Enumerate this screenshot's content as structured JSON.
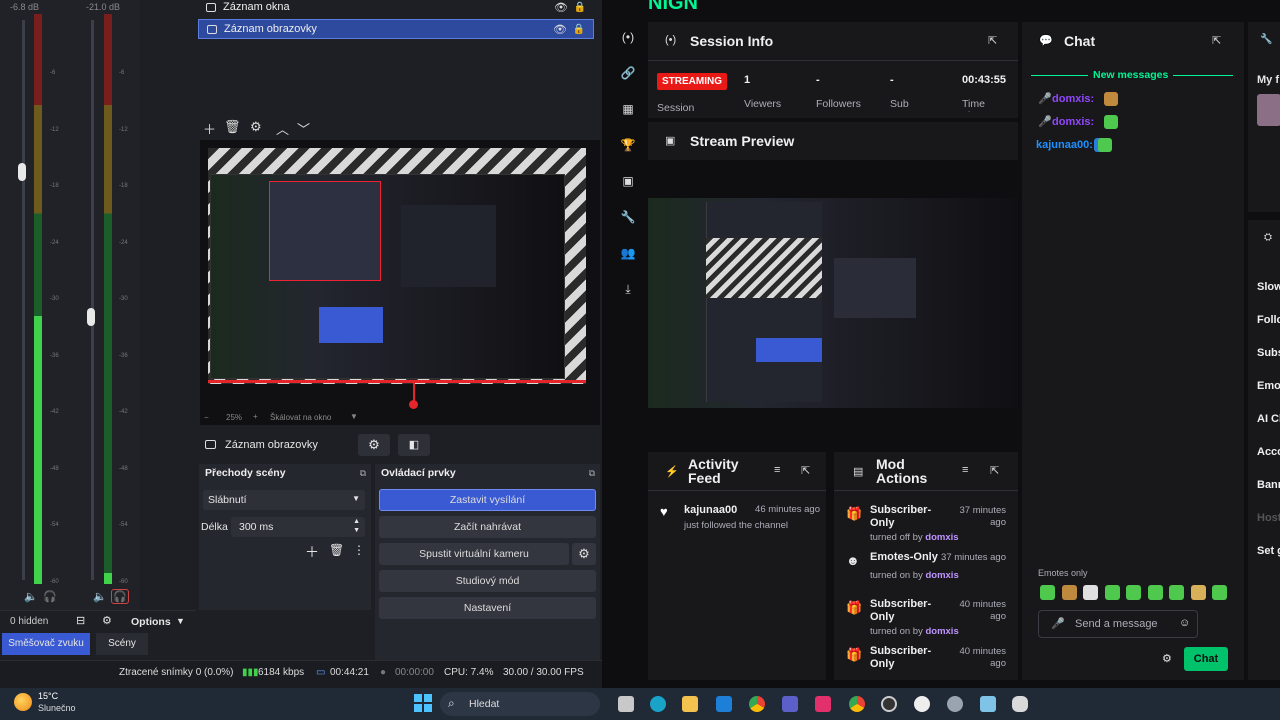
{
  "mixer": {
    "db_left": "-6.8 dB",
    "db_right": "-21.0 dB",
    "ticks": [
      "-6",
      "-12",
      "-18",
      "-24",
      "-30",
      "-36",
      "-42",
      "-48",
      "-54",
      "-60"
    ],
    "level_left": 0.47,
    "level_right": 0.02,
    "hidden_label": "0 hidden",
    "options_label": "Options"
  },
  "sources": {
    "items": [
      {
        "label": "Záznam okna",
        "selected": false
      },
      {
        "label": "Záznam obrazovky",
        "selected": true
      }
    ]
  },
  "preview": {
    "zoom": "25%",
    "scale_label": "Škálovat na okno"
  },
  "source_bar": {
    "label": "Záznam obrazovky"
  },
  "transitions": {
    "title": "Přechody scény",
    "selected": "Slábnutí",
    "duration_label": "Délka",
    "duration_value": "300 ms"
  },
  "controls": {
    "title": "Ovládací prvky",
    "start_stream": "Zastavit vysílání",
    "start_record": "Začít nahrávat",
    "virtual_cam": "Spustit virtuální kameru",
    "studio_mode": "Studiový mód",
    "settings": "Nastavení"
  },
  "docks": {
    "tab_mixer": "Směšovač zvuku",
    "tab_scenes": "Scény"
  },
  "status": {
    "dropped": "Ztracené snímky 0 (0.0%)",
    "bitrate": "6184 kbps",
    "live_time": "00:44:21",
    "rec_time": "00:00:00",
    "cpu": "CPU: 7.4%",
    "fps": "30.00 / 30.00 FPS"
  },
  "dashboard": {
    "brand_partial": "NIGN",
    "session": {
      "title": "Session Info",
      "live_badge": "STREAMING",
      "session_label": "Session",
      "viewers_value": "1",
      "viewers_label": "Viewers",
      "followers_value": "-",
      "followers_label": "Followers",
      "subs_value": "-",
      "subs_label": "Sub Counts",
      "time_value": "00:43:55",
      "time_label": "Time Live"
    },
    "preview_title": "Stream Preview",
    "chat": {
      "title": "Chat",
      "new_messages": "New messages",
      "messages": [
        {
          "user": "domxis:",
          "color": "#9147ff"
        },
        {
          "user": "domxis:",
          "color": "#9147ff"
        },
        {
          "user": "kajunaa00:",
          "color": "#1e90ff"
        }
      ],
      "emotes_only": "Emotes only",
      "input_placeholder": "Send a message",
      "send_label": "Chat"
    },
    "activity": {
      "title": "Activity Feed",
      "items": [
        {
          "user": "kajunaa00",
          "sub": "just followed the channel",
          "time": "46 minutes ago"
        }
      ]
    },
    "mod": {
      "title": "Mod Actions",
      "items": [
        {
          "title": "Subscriber-Only",
          "action": "turned off by",
          "user": "domxis",
          "time": "37 minutes ago"
        },
        {
          "title": "Emotes-Only",
          "action": "turned on by",
          "user": "domxis",
          "time": "37 minutes ago"
        },
        {
          "title": "Subscriber-Only",
          "action": "turned on by",
          "user": "domxis",
          "time": "40 minutes ago"
        },
        {
          "title": "Subscriber-Only",
          "action": "",
          "user": "",
          "time": "40 minutes ago"
        }
      ]
    },
    "side": {
      "my_label": "My f",
      "items": [
        "Slow",
        "Follo",
        "Subs",
        "Emot",
        "AI Cl",
        "Acco",
        "Bann",
        "Host",
        "Set g"
      ]
    }
  },
  "taskbar": {
    "weather_temp": "15°C",
    "weather_desc": "Slunečno",
    "search_placeholder": "Hledat"
  },
  "colors": {
    "accent": "#3a5ad3",
    "twitch_green": "#00f593",
    "live_red": "#e91916",
    "twitch_purple": "#9147ff"
  }
}
